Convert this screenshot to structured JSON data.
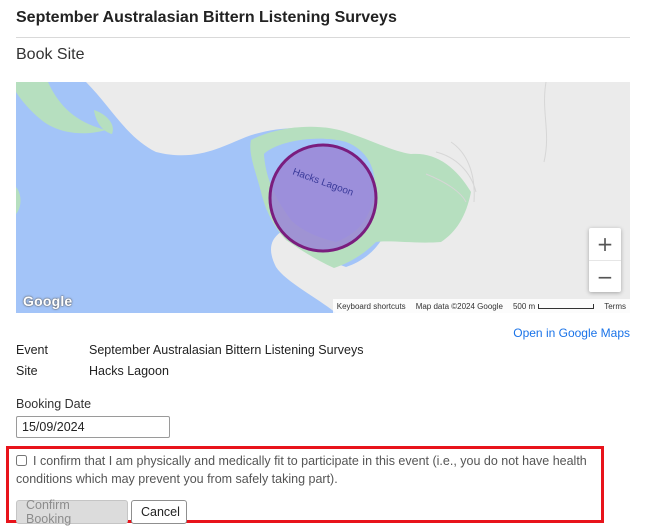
{
  "page": {
    "title": "September Australasian Bittern Listening Surveys",
    "subtitle": "Book Site"
  },
  "map": {
    "site_label": "Hacks Lagoon",
    "zoom_in": "+",
    "zoom_out": "−",
    "logo": "Google",
    "keyboard_shortcuts": "Keyboard shortcuts",
    "map_data": "Map data ©2024 Google",
    "scale": "500 m",
    "terms": "Terms",
    "colors": {
      "water": "#a3c4f8",
      "park": "#b6dfbf",
      "land": "#ebebeb",
      "site_fill": "#9b86d6",
      "site_stroke": "#7a1d7e"
    },
    "open_link": "Open in Google Maps"
  },
  "details": {
    "event_label": "Event",
    "event_value": "September Australasian Bittern Listening Surveys",
    "site_label": "Site",
    "site_value": "Hacks Lagoon"
  },
  "booking": {
    "date_label": "Booking Date",
    "date_value": "15/09/2024",
    "confirm_text": "I confirm that I am physically and medically fit to participate in this event (i.e., you do not have health conditions which may prevent you from safely taking part).",
    "confirm_button": "Confirm Booking",
    "cancel_button": "Cancel"
  },
  "highlight_color": "#e8131b"
}
